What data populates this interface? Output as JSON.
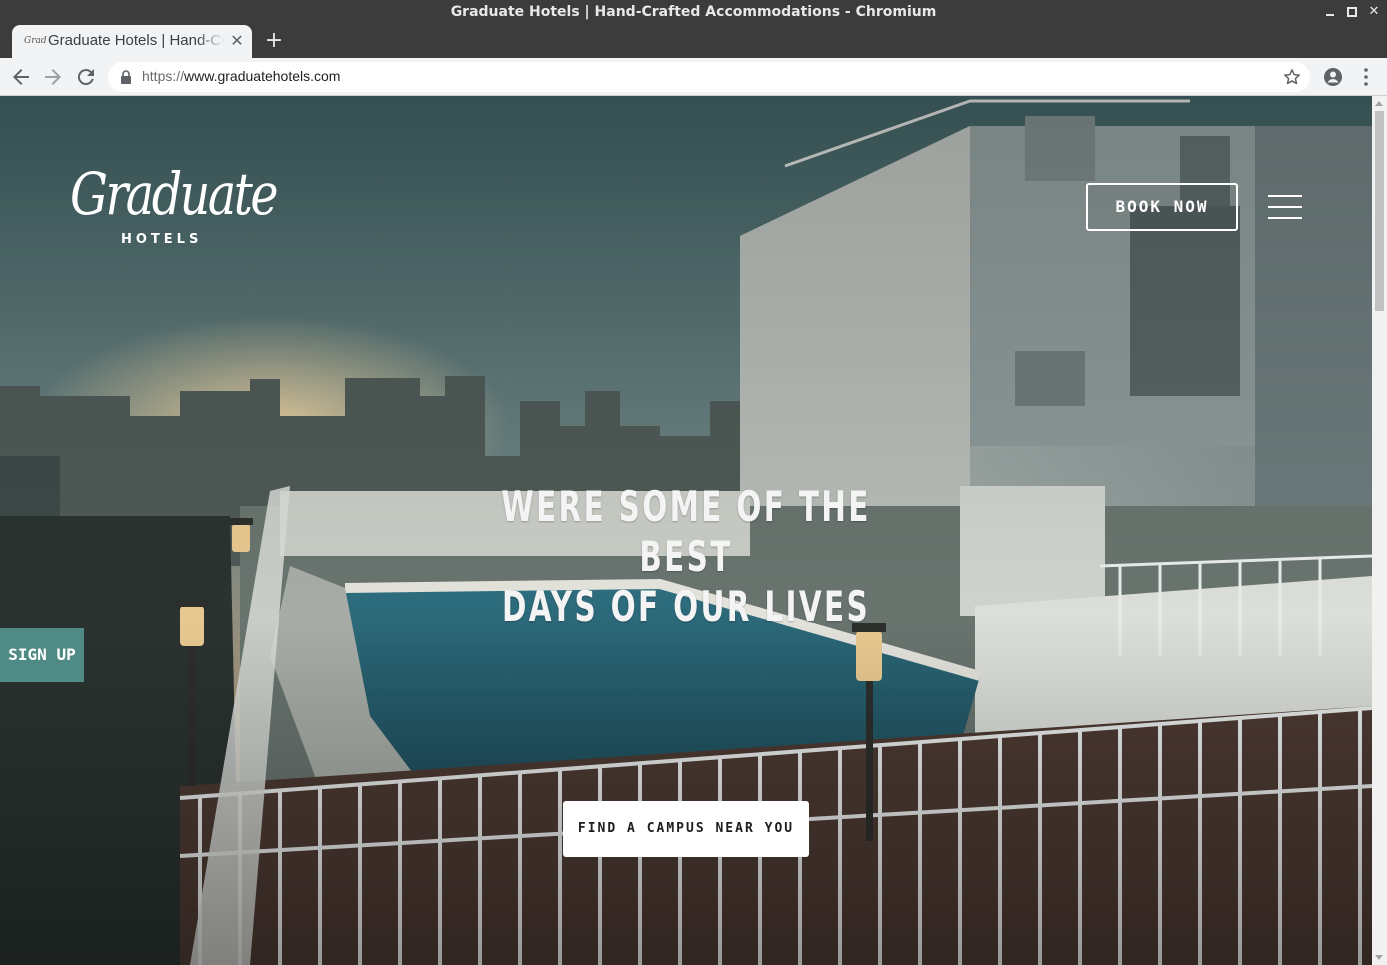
{
  "window": {
    "title": "Graduate Hotels | Hand-Crafted Accommodations - Chromium"
  },
  "tab": {
    "title": "Graduate Hotels | Hand-Crafted Accommodations",
    "favicon": "graduate-script-favicon"
  },
  "toolbar": {
    "url_scheme": "https://",
    "url_host": "www.graduatehotels.com"
  },
  "site": {
    "logo_script": "Graduate",
    "logo_sub": "HOTELS",
    "book_now": "BOOK NOW",
    "headline_line1": "WERE SOME OF THE BEST",
    "headline_line2": "DAYS OF OUR LIVES",
    "sign_up": "SIGN UP",
    "cta": "FIND A CAMPUS NEAR YOU"
  },
  "colors": {
    "chrome_dark": "#3c3c3c",
    "toolbar": "#f1f3f4",
    "signup_bg": "#4f8a84",
    "hero_tint": "#45605f"
  },
  "icons": [
    "back-arrow-icon",
    "forward-arrow-icon",
    "reload-icon",
    "lock-icon",
    "star-icon",
    "profile-icon",
    "menu-dots-icon",
    "hamburger-menu-icon"
  ]
}
